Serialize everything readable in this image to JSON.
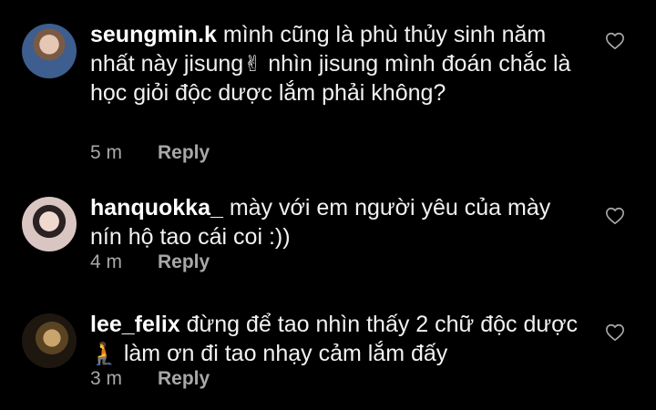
{
  "comments": [
    {
      "username": "seungmin.k",
      "text_before_emoji": "mình cũng là phù thủy sinh năm nhất này jisung",
      "emoji": "✌",
      "text_after_emoji": " nhìn jisung mình đoán chắc là học giỏi độc dược lắm phải không?",
      "time": "5 m",
      "reply_label": "Reply",
      "avatar_icon": "avatar-photo",
      "like_icon": "heart-outline-icon"
    },
    {
      "username": "hanquokka_",
      "text_before_emoji": "mày với em người yêu của mày nín hộ tao cái coi :))",
      "emoji": "",
      "text_after_emoji": "",
      "time": "4 m",
      "reply_label": "Reply",
      "avatar_icon": "avatar-photo",
      "like_icon": "heart-outline-icon"
    },
    {
      "username": "lee_felix",
      "text_before_emoji": "đừng để tao nhìn thấy 2 chữ độc dược",
      "emoji": "🧎",
      "text_after_emoji": " làm ơn đi tao nhạy cảm lắm đấy",
      "time": "3 m",
      "reply_label": "Reply",
      "avatar_icon": "avatar-photo",
      "like_icon": "heart-outline-icon"
    }
  ],
  "colors": {
    "background": "#000000",
    "text": "#f2f2f2",
    "meta": "#a8a8a8"
  }
}
